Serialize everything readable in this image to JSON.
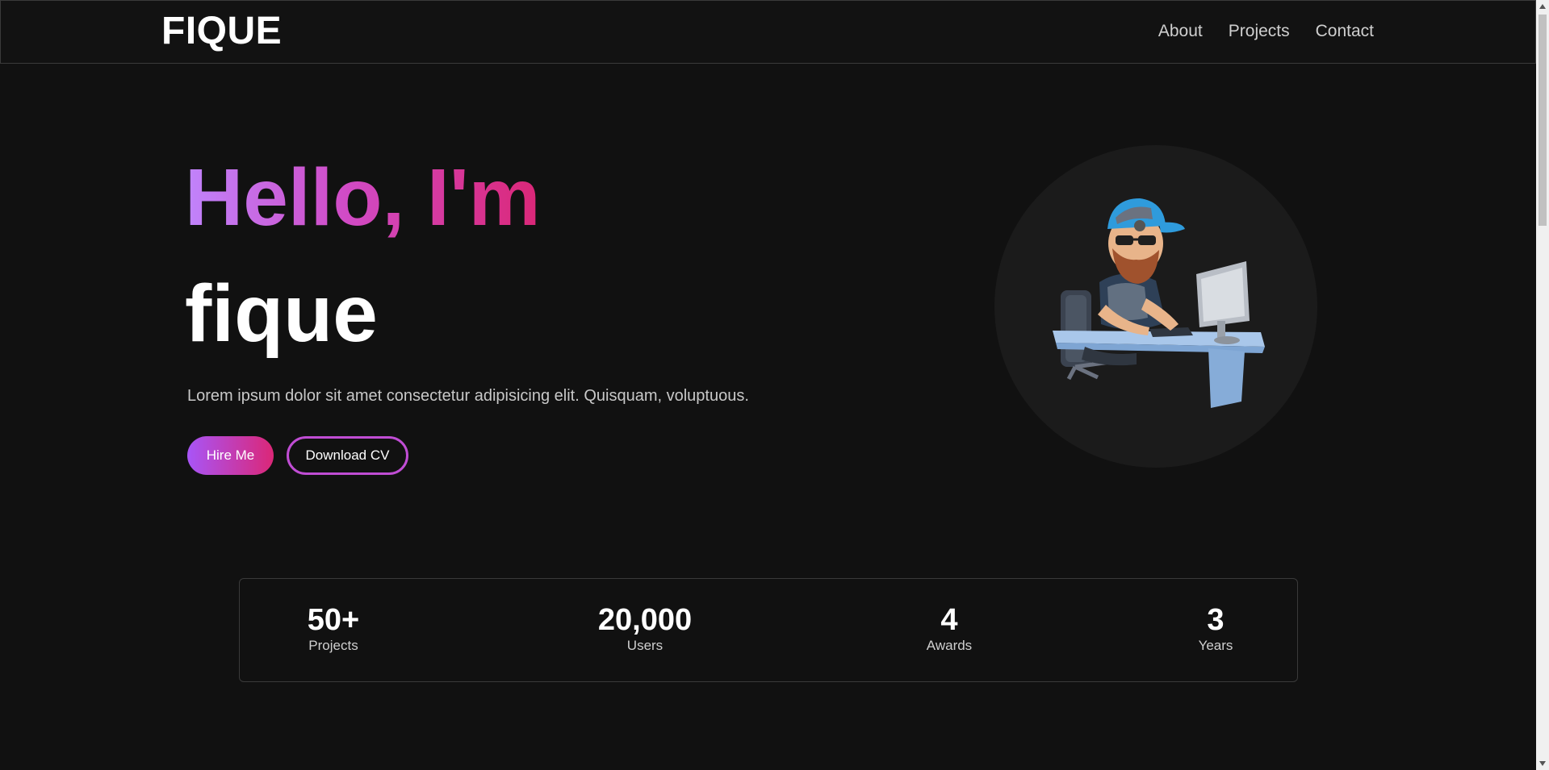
{
  "nav": {
    "brand": "FIQUE",
    "links": [
      "About",
      "Projects",
      "Contact"
    ]
  },
  "hero": {
    "greeting": "Hello, I'm",
    "name": "fique",
    "description": "Lorem ipsum dolor sit amet consectetur adipisicing elit. Quisquam, voluptuous.",
    "hire_label": "Hire Me",
    "cv_label": "Download CV"
  },
  "stats": [
    {
      "value": "50+",
      "label": "Projects"
    },
    {
      "value": "20,000",
      "label": "Users"
    },
    {
      "value": "4",
      "label": "Awards"
    },
    {
      "value": "3",
      "label": "Years"
    }
  ],
  "colors": {
    "background": "#111111",
    "accent_start": "#a855f7",
    "accent_end": "#db2777"
  },
  "icons": {
    "avatar": "developer-avatar-icon",
    "scroll_up": "triangle-up-icon",
    "scroll_down": "triangle-down-icon"
  }
}
